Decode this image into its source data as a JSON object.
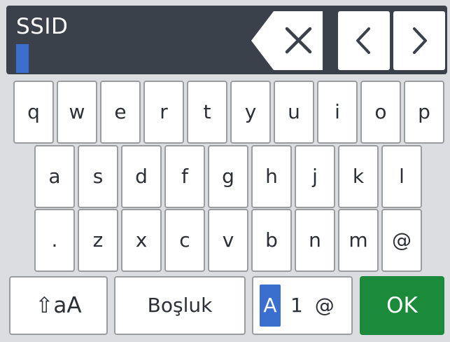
{
  "title": "SSID",
  "cursor_color": "#3a6fd0",
  "icons": {
    "backspace": "backspace-icon",
    "prev": "chevron-left-icon",
    "next": "chevron-right-icon",
    "shift": "shift-arrow-icon"
  },
  "keyboard": {
    "row1": [
      "q",
      "w",
      "e",
      "r",
      "t",
      "y",
      "u",
      "i",
      "o",
      "p"
    ],
    "row2": [
      "a",
      "s",
      "d",
      "f",
      "g",
      "h",
      "j",
      "k",
      "l"
    ],
    "row3": [
      ".",
      "z",
      "x",
      "c",
      "v",
      "b",
      "n",
      "m",
      "@"
    ],
    "shift_label": "aA",
    "shift_glyph": "⇧",
    "space_label": "Boşluk",
    "mode_selected": "A",
    "mode_rest": "1 @",
    "ok_label": "OK"
  },
  "colors": {
    "background": "#dcdde0",
    "header": "#3b414b",
    "ok_green": "#1c8a3b",
    "mode_blue": "#3a6fd0"
  }
}
